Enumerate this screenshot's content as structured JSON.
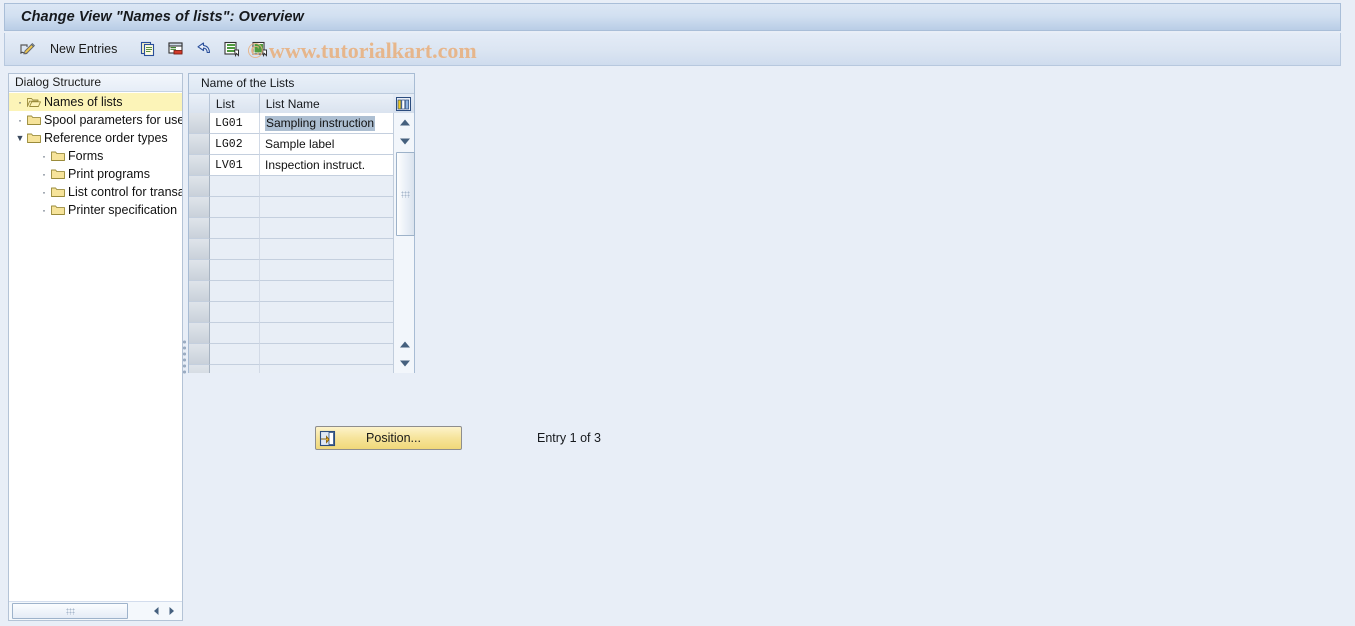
{
  "window": {
    "title": "Change View \"Names of lists\": Overview"
  },
  "toolbar": {
    "edit_icon": "pencil-paper-icon",
    "new_entries_label": "New Entries",
    "buttons": [
      {
        "name": "copy-entry-icon",
        "tooltip": "Copy As..."
      },
      {
        "name": "delete-entry-icon",
        "tooltip": "Delete"
      },
      {
        "name": "undo-icon",
        "tooltip": "Undo Change"
      },
      {
        "name": "select-all-icon",
        "tooltip": "Select All"
      },
      {
        "name": "deselect-all-icon",
        "tooltip": "Deselect All"
      }
    ]
  },
  "watermark": {
    "text": "© www.tutorialkart.com",
    "color": "#e8b384"
  },
  "sidebar": {
    "header": "Dialog Structure",
    "items": [
      {
        "label": "Names of lists",
        "level": 1,
        "selected": true,
        "marker": "bullet",
        "icon": "open-folder-icon"
      },
      {
        "label": "Spool parameters for use",
        "level": 1,
        "selected": false,
        "marker": "bullet",
        "icon": "folder-icon"
      },
      {
        "label": "Reference order types",
        "level": 1,
        "selected": false,
        "marker": "twisty-expanded",
        "icon": "folder-icon"
      },
      {
        "label": "Forms",
        "level": 2,
        "selected": false,
        "marker": "bullet",
        "icon": "folder-icon"
      },
      {
        "label": "Print programs",
        "level": 2,
        "selected": false,
        "marker": "bullet",
        "icon": "folder-icon"
      },
      {
        "label": "List control for transa",
        "level": 2,
        "selected": false,
        "marker": "bullet",
        "icon": "folder-icon"
      },
      {
        "label": "Printer specification",
        "level": 2,
        "selected": false,
        "marker": "bullet",
        "icon": "folder-icon"
      }
    ]
  },
  "table": {
    "title": "Name of the Lists",
    "columns": [
      "List",
      "List Name"
    ],
    "column_config_icon": "table-settings-icon",
    "rows": [
      {
        "list": "LG01",
        "name": "Sampling instruction",
        "selected": true
      },
      {
        "list": "LG02",
        "name": "Sample label",
        "selected": false
      },
      {
        "list": "LV01",
        "name": "Inspection instruct.",
        "selected": false
      }
    ],
    "empty_row_count": 11
  },
  "footer": {
    "position_button_label": "Position...",
    "position_button_icon": "position-icon",
    "entry_count": "Entry 1 of 3"
  }
}
